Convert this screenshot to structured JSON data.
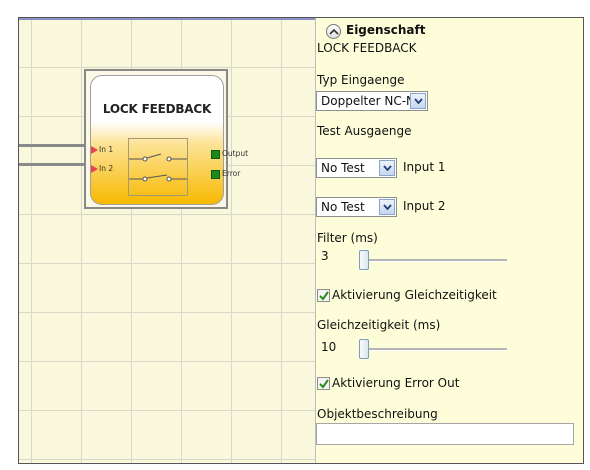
{
  "canvas": {
    "block_title": "LOCK FEEDBACK",
    "inputs": [
      "In 1",
      "In 2"
    ],
    "outputs": [
      "Output",
      "Error"
    ]
  },
  "properties": {
    "header": "Eigenschaft",
    "object_name": "LOCK FEEDBACK",
    "typ_eingaenge_label": "Typ Eingaenge",
    "typ_eingaenge_value": "Doppelter NC-NO",
    "test_ausgaenge_label": "Test Ausgaenge",
    "test1_value": "No Test",
    "test1_label": "Input 1",
    "test2_value": "No Test",
    "test2_label": "Input 2",
    "filter_label": "Filter (ms)",
    "filter_value": "3",
    "gleichzeitigkeit_checkbox_label": "Aktivierung Gleichzeitigkeit",
    "gleichzeitigkeit_checked": true,
    "gleichzeitigkeit_label": "Gleichzeitigkeit (ms)",
    "gleichzeitigkeit_value": "10",
    "error_out_label": "Aktivierung Error Out",
    "error_out_checked": true,
    "objektbeschreibung_label": "Objektbeschreibung",
    "objektbeschreibung_value": ""
  },
  "icons": {
    "collapse": "chevron-up-icon",
    "dropdown": "chevron-down-icon",
    "check": "checkmark-icon"
  },
  "colors": {
    "panel_bg": "#fdfdd9",
    "canvas_bg": "#faf8dc",
    "block_gradient_bottom": "#f7b900",
    "input_arrow": "#e8434a",
    "output_pin": "#1e8a1e"
  }
}
